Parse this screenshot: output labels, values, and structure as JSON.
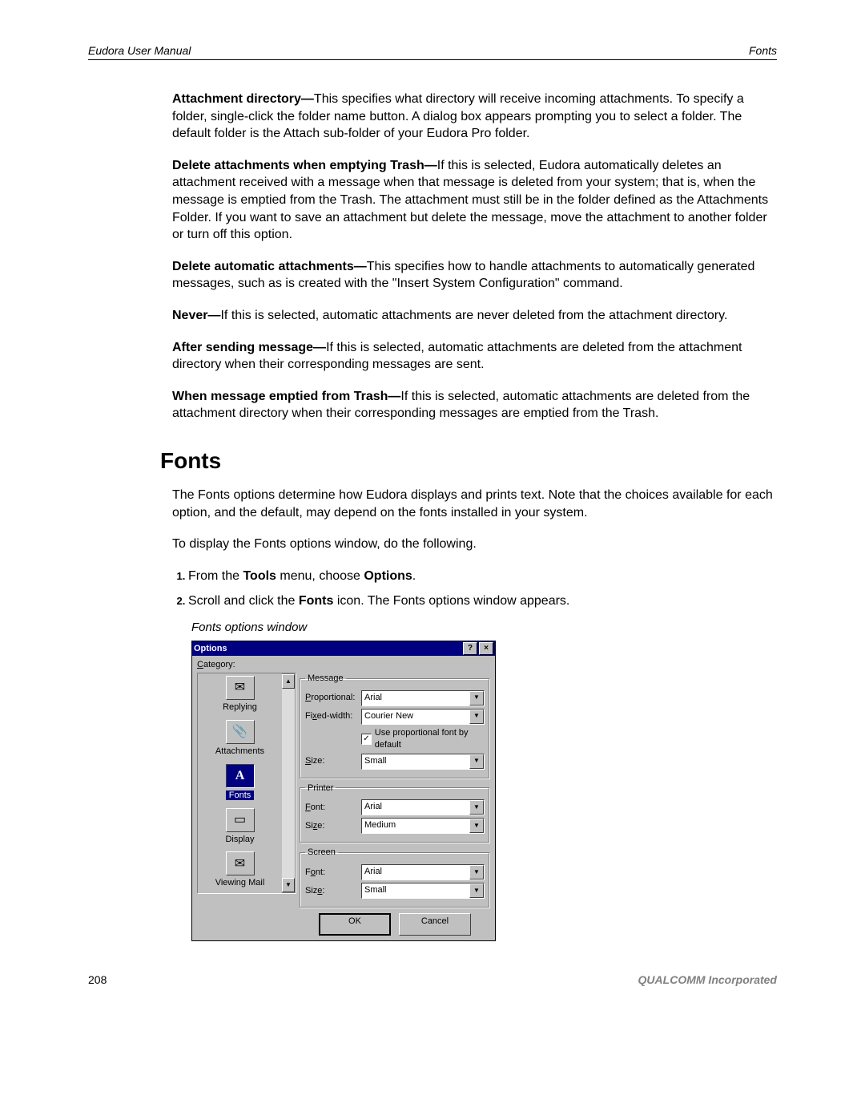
{
  "header": {
    "left": "Eudora User Manual",
    "right": "Fonts"
  },
  "para": {
    "p1_bold": "Attachment directory—",
    "p1": "This specifies what directory will receive incoming attachments. To specify a folder, single-click the folder name button. A dialog box appears prompting you to select a folder. The default folder is the Attach sub-folder of your Eudora Pro folder.",
    "p2_bold": "Delete attachments when emptying Trash—",
    "p2": "If this is selected, Eudora automatically deletes an attachment received with a message when that message is deleted from your system; that is, when the message is emptied from the Trash. The attachment must still be in the folder defined as the Attachments Folder. If you want to save an attachment but delete the message, move the attachment to another folder or turn off this option.",
    "p3_bold": "Delete automatic attachments—",
    "p3": "This specifies how to handle attachments to automatically generated messages, such as is created with the \"Insert System Configuration\" command.",
    "p4_bold": "Never—",
    "p4": "If this is selected, automatic attachments are never deleted from the attachment directory.",
    "p5_bold": "After sending message—",
    "p5": "If this is selected, automatic attachments are deleted from the attachment directory when their corresponding messages are sent.",
    "p6_bold": "When message emptied from Trash—",
    "p6": "If this is selected, automatic attachments are deleted from the attachment directory when their corresponding messages are emptied from the Trash."
  },
  "section": {
    "heading": "Fonts",
    "intro": "The Fonts options determine how Eudora displays and prints text. Note that the choices available for each option, and the default, may depend on the fonts installed in your system.",
    "instruct": "To display the Fonts options window, do the following.",
    "step1_pre": "From the ",
    "step1_b1": "Tools",
    "step1_mid": " menu, choose ",
    "step1_b2": "Options",
    "step1_post": ".",
    "step2_pre": "Scroll and click the ",
    "step2_b": "Fonts",
    "step2_post": " icon. The Fonts options window appears.",
    "caption": "Fonts options window"
  },
  "dialog": {
    "title": "Options",
    "categoryLabel": "Category:",
    "categories": {
      "c0": "Replying",
      "c1": "Attachments",
      "c2": "Fonts",
      "c3": "Display",
      "c4": "Viewing Mail"
    },
    "groups": {
      "message": {
        "legend": "Message",
        "proportional_label": "Proportional:",
        "proportional": "Arial",
        "fixed_label": "Fixed-width:",
        "fixed": "Courier New",
        "checkbox": "Use proportional font by default",
        "size_label": "Size:",
        "size": "Small"
      },
      "printer": {
        "legend": "Printer",
        "font_label": "Font:",
        "font": "Arial",
        "size_label": "Size:",
        "size": "Medium"
      },
      "screen": {
        "legend": "Screen",
        "font_label": "Font:",
        "font": "Arial",
        "size_label": "Size:",
        "size": "Small"
      }
    },
    "buttons": {
      "ok": "OK",
      "cancel": "Cancel"
    }
  },
  "footer": {
    "page": "208",
    "corp": "QUALCOMM Incorporated"
  },
  "icons": {
    "replying": "✉",
    "attachments": "📎",
    "fonts": "A",
    "display": "▭",
    "viewing": "✉"
  }
}
